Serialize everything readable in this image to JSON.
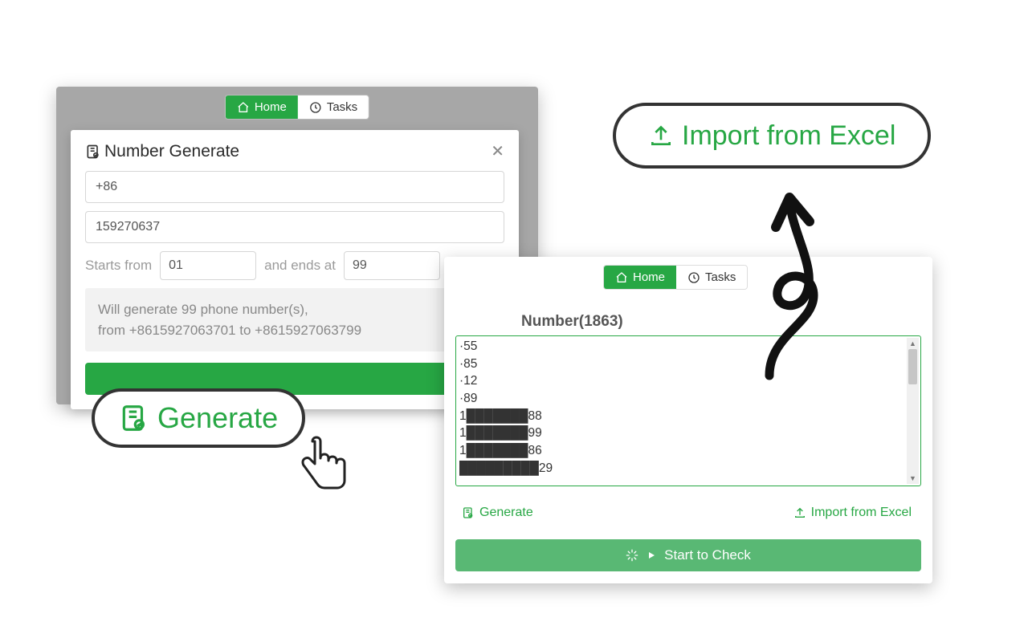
{
  "green": "#27a744",
  "tabs": {
    "home": "Home",
    "tasks": "Tasks"
  },
  "modal": {
    "title": "Number Generate",
    "country_code": "+86",
    "prefix": "159270637",
    "starts_label": "Starts from",
    "ends_label": "and ends at",
    "start_value": "01",
    "end_value": "99",
    "info_line1": "Will generate 99 phone number(s),",
    "info_line2": "from +8615927063701 to +8615927063799"
  },
  "callouts": {
    "generate": "Generate",
    "import": "Import from Excel"
  },
  "right": {
    "header": "Number(1863)",
    "lines": [
      "·55",
      "·85",
      "·12",
      "·89",
      "1███████88",
      "1███████99",
      "1███████86",
      "█████████29"
    ],
    "generate_link": "Generate",
    "import_link": "Import from Excel",
    "start_btn": "Start to Check"
  }
}
